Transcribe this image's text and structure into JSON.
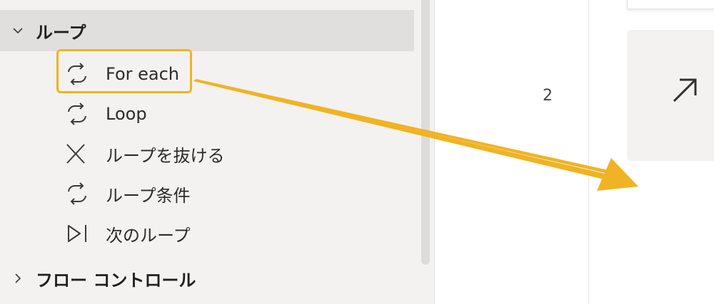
{
  "sidebar": {
    "loop_group": {
      "label": "ループ",
      "expanded": true,
      "icon": "chevron-down-icon"
    },
    "items": [
      {
        "label": "For each",
        "icon": "loop-icon"
      },
      {
        "label": "Loop",
        "icon": "loop-icon"
      },
      {
        "label": "ループを抜ける",
        "icon": "close-x-icon"
      },
      {
        "label": "ループ条件",
        "icon": "loop-icon"
      },
      {
        "label": "次のループ",
        "icon": "next-icon"
      }
    ],
    "flow_group": {
      "label": "フロー コントロール",
      "expanded": false,
      "icon": "chevron-right-icon"
    }
  },
  "canvas": {
    "line_number": "2",
    "card_icon": "arrow-up-right-icon"
  },
  "colors": {
    "highlight": "#f0b323",
    "arrow": "#f0b323",
    "pane_bg": "#f3f2f1",
    "selected_group_bg": "#e1dfdd"
  }
}
